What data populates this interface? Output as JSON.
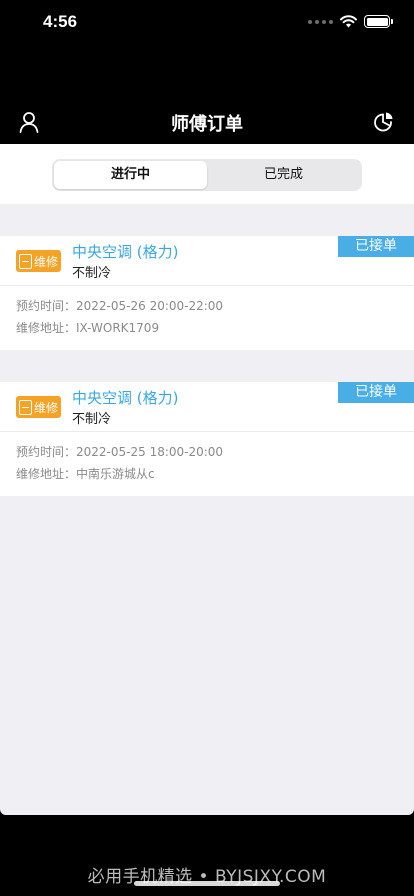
{
  "status_bar": {
    "time": "4:56"
  },
  "nav": {
    "title": "师傅订单",
    "left_icon": "user-icon",
    "right_icon": "pie-chart-icon"
  },
  "segments": [
    {
      "label": "进行中",
      "active": true
    },
    {
      "label": "已完成",
      "active": false
    }
  ],
  "orders": [
    {
      "type_label": "维修",
      "title": "中央空调 (格力)",
      "problem": "不制冷",
      "status": "已接单",
      "time_label": "预约时间：",
      "time": "2022-05-26 20:00-22:00",
      "address_label": "维修地址：",
      "address": "IX-WORK1709"
    },
    {
      "type_label": "维修",
      "title": "中央空调 (格力)",
      "problem": "不制冷",
      "status": "已接单",
      "time_label": "预约时间：",
      "time": "2022-05-25 18:00-20:00",
      "address_label": "维修地址：",
      "address": "中南乐游城从c"
    }
  ],
  "watermark": "必用手机精选 • BYJSJXY.COM",
  "colors": {
    "accent": "#3aa8e0",
    "status_tag": "#4aaee6",
    "type_badge": "#f5a326",
    "background": "#efeff4"
  }
}
